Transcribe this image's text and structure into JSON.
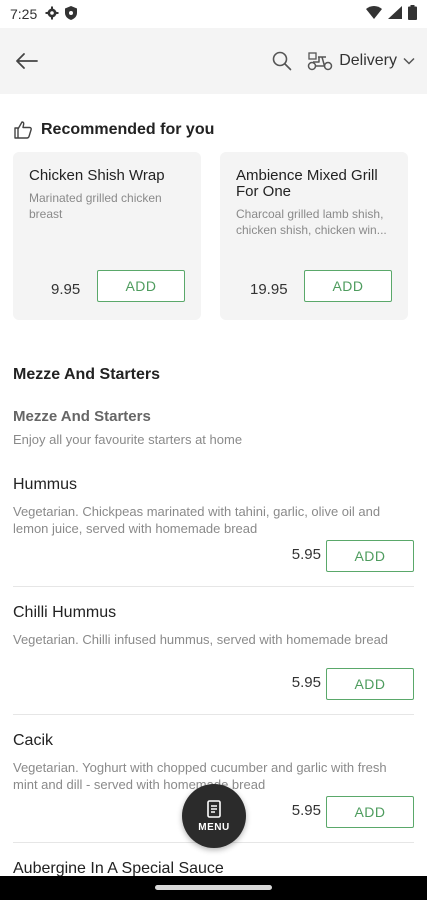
{
  "status_bar": {
    "time": "7:25"
  },
  "top_bar": {
    "delivery_label": "Delivery"
  },
  "recommended": {
    "title": "Recommended for you",
    "cards": [
      {
        "name": "Chicken Shish Wrap",
        "desc": "Marinated grilled chicken breast",
        "price": "9.95",
        "add_label": "ADD"
      },
      {
        "name": "Ambience Mixed Grill For One",
        "desc": "Charcoal grilled lamb shish, chicken shish, chicken win...",
        "price": "19.95",
        "add_label": "ADD"
      }
    ]
  },
  "section": {
    "title": "Mezze And Starters",
    "subtitle": "Mezze And Starters",
    "subtitle_desc": "Enjoy all your favourite starters at home"
  },
  "items": [
    {
      "name": "Hummus",
      "desc": "Vegetarian. Chickpeas marinated with tahini, garlic, olive oil and lemon juice, served with homemade bread",
      "price": "5.95",
      "add_label": "ADD"
    },
    {
      "name": "Chilli Hummus",
      "desc": "Vegetarian.  Chilli infused hummus,  served with homemade bread",
      "price": "5.95",
      "add_label": "ADD"
    },
    {
      "name": "Cacik",
      "desc": "Vegetarian. Yoghurt with chopped cucumber and garlic with fresh mint and dill - served with homemade bread",
      "price": "5.95",
      "add_label": "ADD"
    },
    {
      "name": "Aubergine In A Special Sauce"
    }
  ],
  "fab": {
    "label": "MENU"
  },
  "colors": {
    "accent": "#4e9c5e",
    "card_bg": "#f4f4f4",
    "fab_bg": "#2b2b2b"
  }
}
